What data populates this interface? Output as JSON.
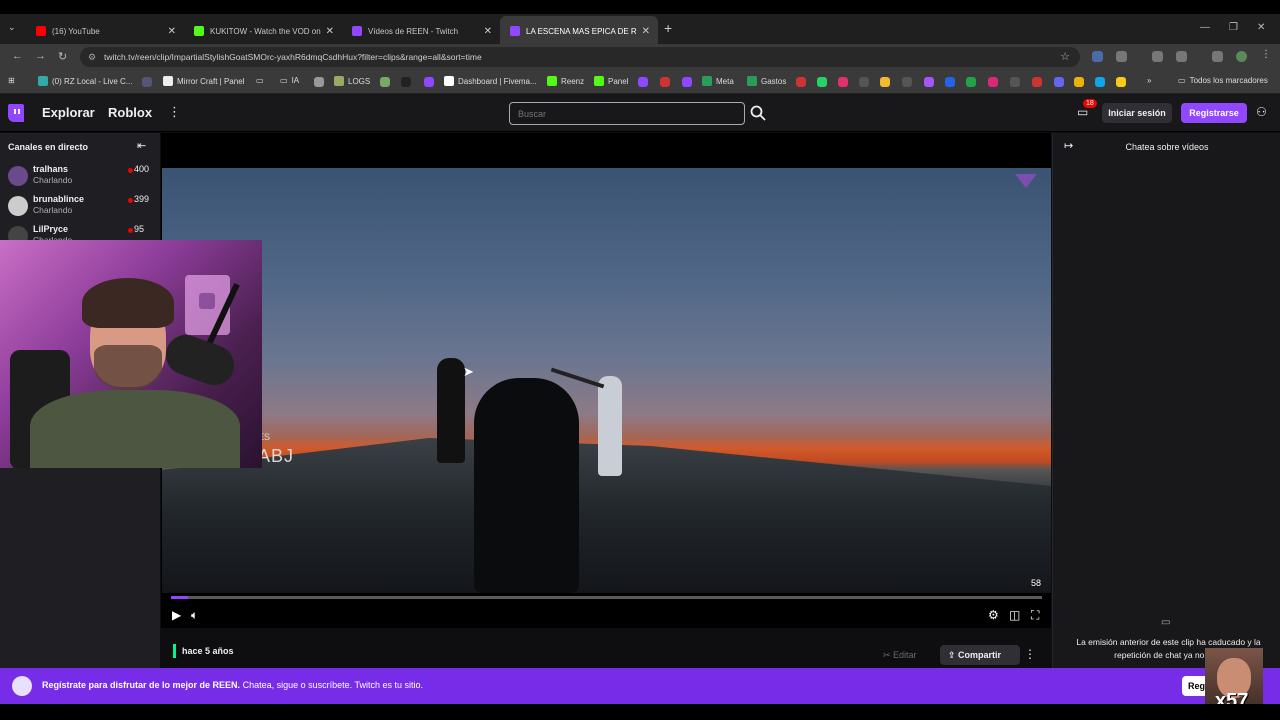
{
  "browser": {
    "tabs": [
      {
        "label": "(16) YouTube",
        "color": "#ff0000"
      },
      {
        "label": "KUKITOW - Watch the VOD on",
        "color": "#53fc18"
      },
      {
        "label": "Vídeos de REEN - Twitch",
        "color": "#9146ff"
      },
      {
        "label": "LA ESCENA MAS EPICA DE ROL",
        "color": "#9146ff"
      }
    ],
    "url": "twitch.tv/reen/clip/ImpartialStylishGoatSMOrc-yaxhR6dmqCsdhHux?filter=clips&range=all&sort=time",
    "bookmarks": [
      "(0) RZ Local - Live C...",
      "Mirror Craft | Panel",
      "IA",
      "LOGS",
      "Dashboard | Fivema...",
      "Reenz",
      "Panel",
      "Meta",
      "Gastos"
    ],
    "all_bookmarks": "Todos los marcadores"
  },
  "twitch": {
    "nav": {
      "explore": "Explorar",
      "game": "Roblox",
      "search_placeholder": "Buscar",
      "notif_count": "18",
      "login": "Iniciar sesión",
      "signup": "Registrarse"
    },
    "sidebar": {
      "title": "Canales en directo",
      "channels": [
        {
          "name": "tralhans",
          "category": "Charlando",
          "viewers": "400"
        },
        {
          "name": "brunablince",
          "category": "Charlando",
          "viewers": "399"
        },
        {
          "name": "LilPryce",
          "category": "Charlando",
          "viewers": "95"
        }
      ]
    },
    "player": {
      "watermark": "ABJ",
      "watermark_small": "ES",
      "fps": "58",
      "progress_fraction": 0.02
    },
    "info": {
      "time_ago": "hace 5 años",
      "edit": "Editar",
      "share": "Compartir"
    },
    "chat": {
      "title": "Chatea sobre vídeos",
      "message": "La emisión anterior de este clip ha caducado y la repetición de chat ya no está"
    },
    "banner": {
      "bold": "Regístrate para disfrutar de lo mejor de REEN.",
      "text": " Chatea, sigue o suscríbete. Twitch es tu sitio.",
      "button": "Regi",
      "overlay_text": "x57"
    }
  }
}
